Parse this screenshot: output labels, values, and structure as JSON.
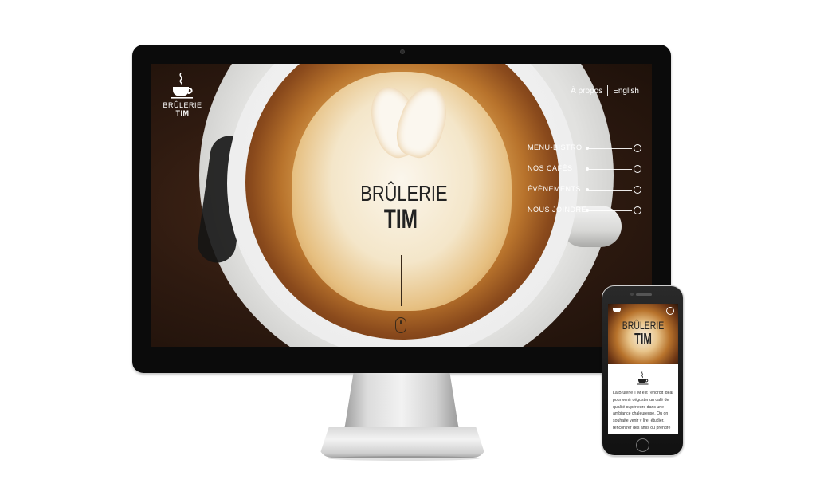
{
  "site": {
    "logo_line1": "BRÛLERIE",
    "logo_line2": "TIM",
    "nav": {
      "about": "À propos",
      "language": "English"
    },
    "menu": [
      {
        "label": "MENU-BISTRO"
      },
      {
        "label": "NOS CAFÉS"
      },
      {
        "label": "ÉVÈNEMENTS"
      },
      {
        "label": "NOUS JOINDRE"
      }
    ],
    "hero_title_line1": "BRÛLERIE",
    "hero_title_line2": "TIM"
  },
  "mobile": {
    "hero_title_line1": "BRÛLERIE",
    "hero_title_line2": "TIM",
    "intro_text": "La Brûlerie TIM est l'endroit idéal pour venir déguster un café de qualité supérieure dans une ambiance chaleureuse. Où on souhaite venir y lire, étudier, rencontrer des amis ou prendre"
  },
  "colors": {
    "text_light": "#ffffff",
    "title_dark": "#222222",
    "bezel": "#0b0b0b"
  }
}
